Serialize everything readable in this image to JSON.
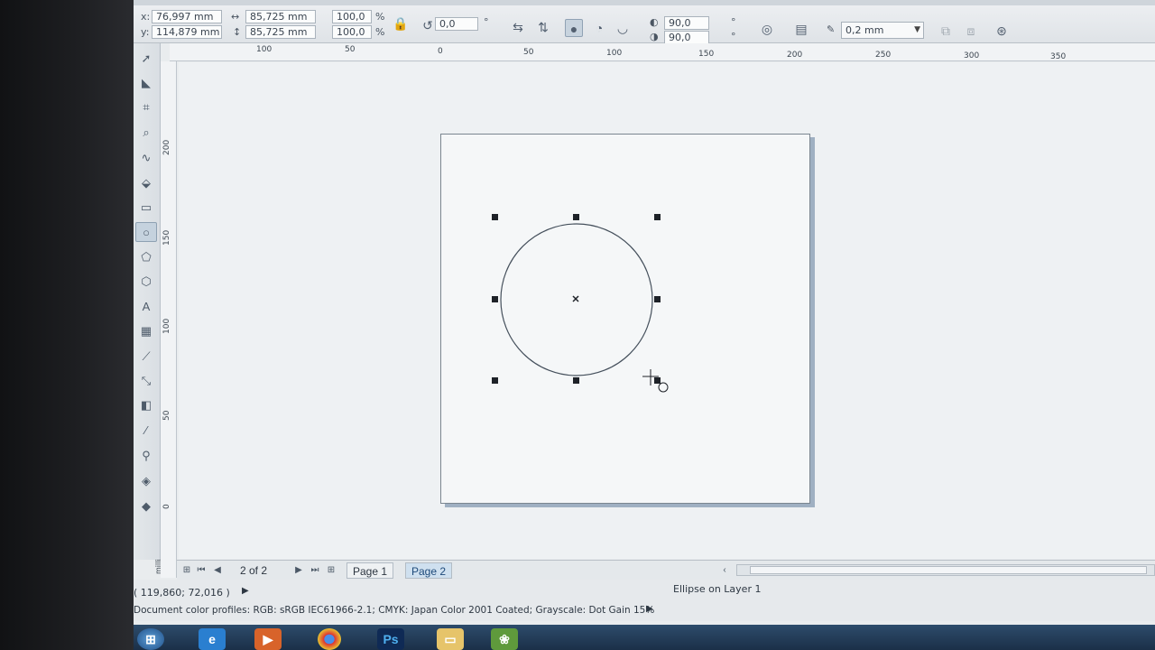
{
  "property_bar": {
    "x_value": "76,997 mm",
    "y_value": "114,879 mm",
    "x_label": "x:",
    "y_label": "y:",
    "width_value": "85,725 mm",
    "height_value": "85,725 mm",
    "scale_x": "100,0",
    "scale_y": "100,0",
    "percent": "%",
    "rotation": "0,0",
    "degree": "°",
    "start_angle": "90,0",
    "end_angle": "90,0",
    "outline_width": "0,2 mm"
  },
  "ruler_top": {
    "ticks": [
      "100",
      "50",
      "0",
      "50",
      "100",
      "150",
      "200",
      "250",
      "300",
      "350"
    ]
  },
  "ruler_left": {
    "ticks": [
      "200",
      "150",
      "100",
      "50",
      "0"
    ],
    "unit": "millimeters"
  },
  "page_nav": {
    "counter": "2 of 2",
    "tabs": [
      {
        "label": "Page 1",
        "active": false
      },
      {
        "label": "Page 2",
        "active": true
      }
    ]
  },
  "status": {
    "cursor_coords": "( 119,860; 72,016 )",
    "selection_info": "Ellipse on Layer 1",
    "color_profiles": "Document color profiles: RGB: sRGB IEC61966-2.1; CMYK: Japan Color 2001 Coated; Grayscale: Dot Gain 15%"
  },
  "taskbar": {
    "icons": [
      "windows-start-icon",
      "internet-explorer-icon",
      "media-player-icon",
      "chrome-icon",
      "photoshop-icon",
      "file-explorer-icon",
      "coreldraw-icon"
    ],
    "photoshop_label": "Ps"
  },
  "colors": {
    "accent": "#1e4a7a",
    "page_shadow": "#9fb0c2",
    "ellipse_stroke": "#45505c"
  }
}
